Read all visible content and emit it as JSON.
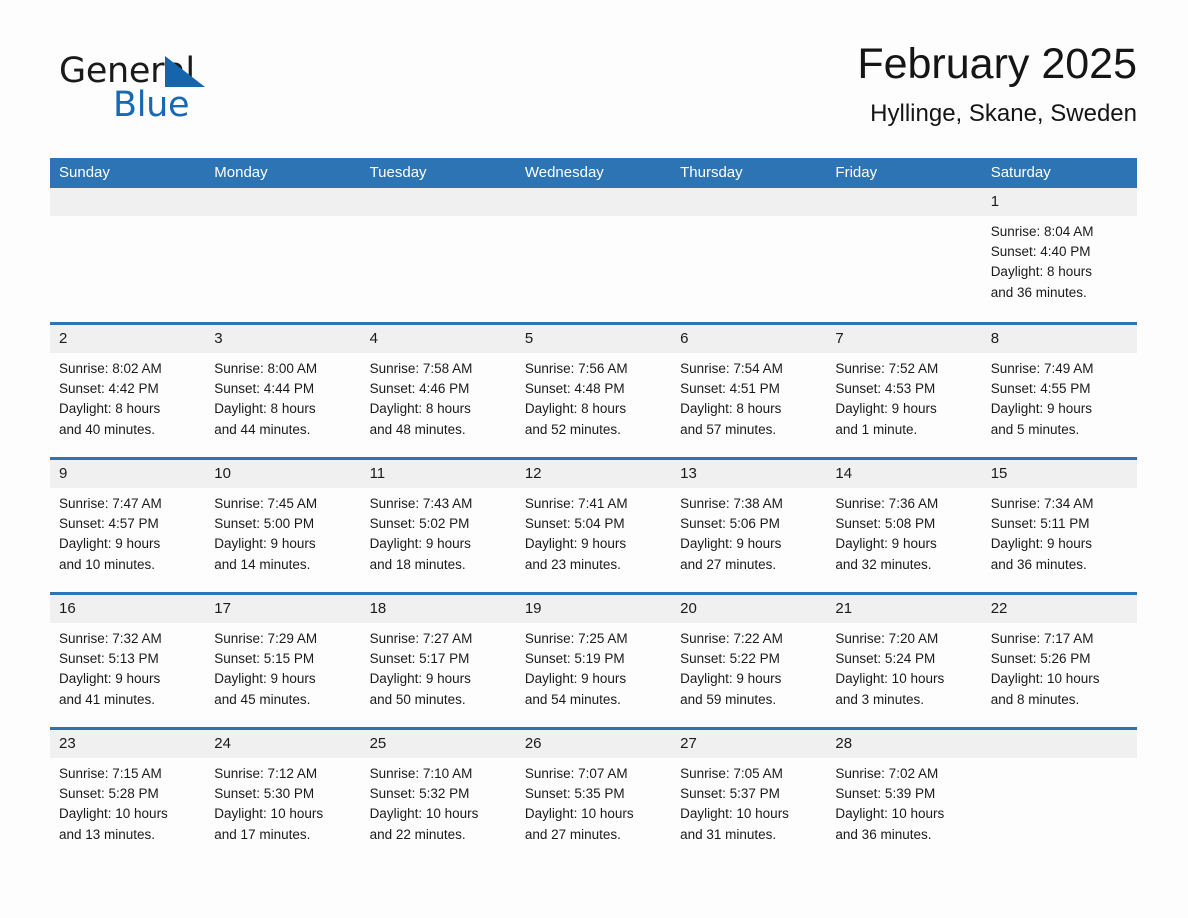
{
  "brand": {
    "name_part1": "General",
    "name_part2": "Blue",
    "triangle_color": "#1565ad",
    "blue_color": "#1769b5"
  },
  "header": {
    "title": "February 2025",
    "subtitle": "Hyllinge, Skane, Sweden"
  },
  "theme": {
    "header_blue": "#2d74b5",
    "daynum_band": "#f0f0f0",
    "page_background": "#fdfdfd",
    "text": "#1a1a1a"
  },
  "weekdays": [
    "Sunday",
    "Monday",
    "Tuesday",
    "Wednesday",
    "Thursday",
    "Friday",
    "Saturday"
  ],
  "weeks": [
    [
      {
        "day": "",
        "empty": true,
        "l1": "",
        "l2": "",
        "l3": "",
        "l4": ""
      },
      {
        "day": "",
        "empty": true,
        "l1": "",
        "l2": "",
        "l3": "",
        "l4": ""
      },
      {
        "day": "",
        "empty": true,
        "l1": "",
        "l2": "",
        "l3": "",
        "l4": ""
      },
      {
        "day": "",
        "empty": true,
        "l1": "",
        "l2": "",
        "l3": "",
        "l4": ""
      },
      {
        "day": "",
        "empty": true,
        "l1": "",
        "l2": "",
        "l3": "",
        "l4": ""
      },
      {
        "day": "",
        "empty": true,
        "l1": "",
        "l2": "",
        "l3": "",
        "l4": ""
      },
      {
        "day": "1",
        "empty": false,
        "l1": "Sunrise: 8:04 AM",
        "l2": "Sunset: 4:40 PM",
        "l3": "Daylight: 8 hours",
        "l4": "and 36 minutes."
      }
    ],
    [
      {
        "day": "2",
        "empty": false,
        "l1": "Sunrise: 8:02 AM",
        "l2": "Sunset: 4:42 PM",
        "l3": "Daylight: 8 hours",
        "l4": "and 40 minutes."
      },
      {
        "day": "3",
        "empty": false,
        "l1": "Sunrise: 8:00 AM",
        "l2": "Sunset: 4:44 PM",
        "l3": "Daylight: 8 hours",
        "l4": "and 44 minutes."
      },
      {
        "day": "4",
        "empty": false,
        "l1": "Sunrise: 7:58 AM",
        "l2": "Sunset: 4:46 PM",
        "l3": "Daylight: 8 hours",
        "l4": "and 48 minutes."
      },
      {
        "day": "5",
        "empty": false,
        "l1": "Sunrise: 7:56 AM",
        "l2": "Sunset: 4:48 PM",
        "l3": "Daylight: 8 hours",
        "l4": "and 52 minutes."
      },
      {
        "day": "6",
        "empty": false,
        "l1": "Sunrise: 7:54 AM",
        "l2": "Sunset: 4:51 PM",
        "l3": "Daylight: 8 hours",
        "l4": "and 57 minutes."
      },
      {
        "day": "7",
        "empty": false,
        "l1": "Sunrise: 7:52 AM",
        "l2": "Sunset: 4:53 PM",
        "l3": "Daylight: 9 hours",
        "l4": "and 1 minute."
      },
      {
        "day": "8",
        "empty": false,
        "l1": "Sunrise: 7:49 AM",
        "l2": "Sunset: 4:55 PM",
        "l3": "Daylight: 9 hours",
        "l4": "and 5 minutes."
      }
    ],
    [
      {
        "day": "9",
        "empty": false,
        "l1": "Sunrise: 7:47 AM",
        "l2": "Sunset: 4:57 PM",
        "l3": "Daylight: 9 hours",
        "l4": "and 10 minutes."
      },
      {
        "day": "10",
        "empty": false,
        "l1": "Sunrise: 7:45 AM",
        "l2": "Sunset: 5:00 PM",
        "l3": "Daylight: 9 hours",
        "l4": "and 14 minutes."
      },
      {
        "day": "11",
        "empty": false,
        "l1": "Sunrise: 7:43 AM",
        "l2": "Sunset: 5:02 PM",
        "l3": "Daylight: 9 hours",
        "l4": "and 18 minutes."
      },
      {
        "day": "12",
        "empty": false,
        "l1": "Sunrise: 7:41 AM",
        "l2": "Sunset: 5:04 PM",
        "l3": "Daylight: 9 hours",
        "l4": "and 23 minutes."
      },
      {
        "day": "13",
        "empty": false,
        "l1": "Sunrise: 7:38 AM",
        "l2": "Sunset: 5:06 PM",
        "l3": "Daylight: 9 hours",
        "l4": "and 27 minutes."
      },
      {
        "day": "14",
        "empty": false,
        "l1": "Sunrise: 7:36 AM",
        "l2": "Sunset: 5:08 PM",
        "l3": "Daylight: 9 hours",
        "l4": "and 32 minutes."
      },
      {
        "day": "15",
        "empty": false,
        "l1": "Sunrise: 7:34 AM",
        "l2": "Sunset: 5:11 PM",
        "l3": "Daylight: 9 hours",
        "l4": "and 36 minutes."
      }
    ],
    [
      {
        "day": "16",
        "empty": false,
        "l1": "Sunrise: 7:32 AM",
        "l2": "Sunset: 5:13 PM",
        "l3": "Daylight: 9 hours",
        "l4": "and 41 minutes."
      },
      {
        "day": "17",
        "empty": false,
        "l1": "Sunrise: 7:29 AM",
        "l2": "Sunset: 5:15 PM",
        "l3": "Daylight: 9 hours",
        "l4": "and 45 minutes."
      },
      {
        "day": "18",
        "empty": false,
        "l1": "Sunrise: 7:27 AM",
        "l2": "Sunset: 5:17 PM",
        "l3": "Daylight: 9 hours",
        "l4": "and 50 minutes."
      },
      {
        "day": "19",
        "empty": false,
        "l1": "Sunrise: 7:25 AM",
        "l2": "Sunset: 5:19 PM",
        "l3": "Daylight: 9 hours",
        "l4": "and 54 minutes."
      },
      {
        "day": "20",
        "empty": false,
        "l1": "Sunrise: 7:22 AM",
        "l2": "Sunset: 5:22 PM",
        "l3": "Daylight: 9 hours",
        "l4": "and 59 minutes."
      },
      {
        "day": "21",
        "empty": false,
        "l1": "Sunrise: 7:20 AM",
        "l2": "Sunset: 5:24 PM",
        "l3": "Daylight: 10 hours",
        "l4": "and 3 minutes."
      },
      {
        "day": "22",
        "empty": false,
        "l1": "Sunrise: 7:17 AM",
        "l2": "Sunset: 5:26 PM",
        "l3": "Daylight: 10 hours",
        "l4": "and 8 minutes."
      }
    ],
    [
      {
        "day": "23",
        "empty": false,
        "l1": "Sunrise: 7:15 AM",
        "l2": "Sunset: 5:28 PM",
        "l3": "Daylight: 10 hours",
        "l4": "and 13 minutes."
      },
      {
        "day": "24",
        "empty": false,
        "l1": "Sunrise: 7:12 AM",
        "l2": "Sunset: 5:30 PM",
        "l3": "Daylight: 10 hours",
        "l4": "and 17 minutes."
      },
      {
        "day": "25",
        "empty": false,
        "l1": "Sunrise: 7:10 AM",
        "l2": "Sunset: 5:32 PM",
        "l3": "Daylight: 10 hours",
        "l4": "and 22 minutes."
      },
      {
        "day": "26",
        "empty": false,
        "l1": "Sunrise: 7:07 AM",
        "l2": "Sunset: 5:35 PM",
        "l3": "Daylight: 10 hours",
        "l4": "and 27 minutes."
      },
      {
        "day": "27",
        "empty": false,
        "l1": "Sunrise: 7:05 AM",
        "l2": "Sunset: 5:37 PM",
        "l3": "Daylight: 10 hours",
        "l4": "and 31 minutes."
      },
      {
        "day": "28",
        "empty": false,
        "l1": "Sunrise: 7:02 AM",
        "l2": "Sunset: 5:39 PM",
        "l3": "Daylight: 10 hours",
        "l4": "and 36 minutes."
      },
      {
        "day": "",
        "empty": true,
        "l1": "",
        "l2": "",
        "l3": "",
        "l4": ""
      }
    ]
  ]
}
